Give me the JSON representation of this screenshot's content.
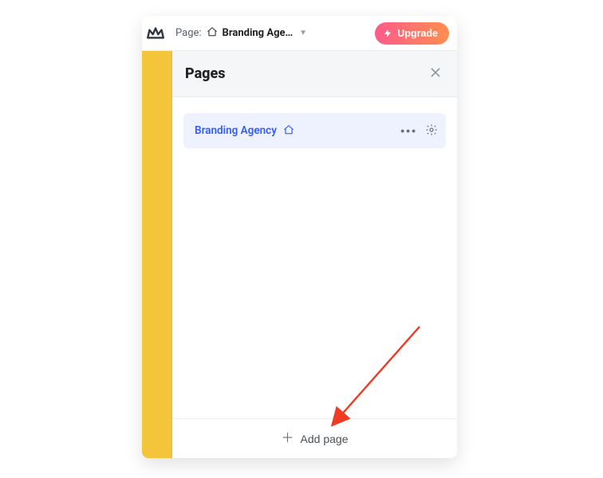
{
  "topbar": {
    "page_label": "Page:",
    "page_title": "Branding Age…",
    "upgrade_label": "Upgrade"
  },
  "panel": {
    "title": "Pages",
    "pages": [
      {
        "name": "Branding Agency"
      }
    ],
    "add_page_label": "Add page"
  },
  "icons": {
    "logo": "crown-logo-icon",
    "home": "home-icon",
    "chevron_down": "chevron-down-icon",
    "bolt": "lightning-icon",
    "close": "close-icon",
    "more": "more-icon",
    "gear": "gear-icon",
    "plus": "plus-icon"
  }
}
